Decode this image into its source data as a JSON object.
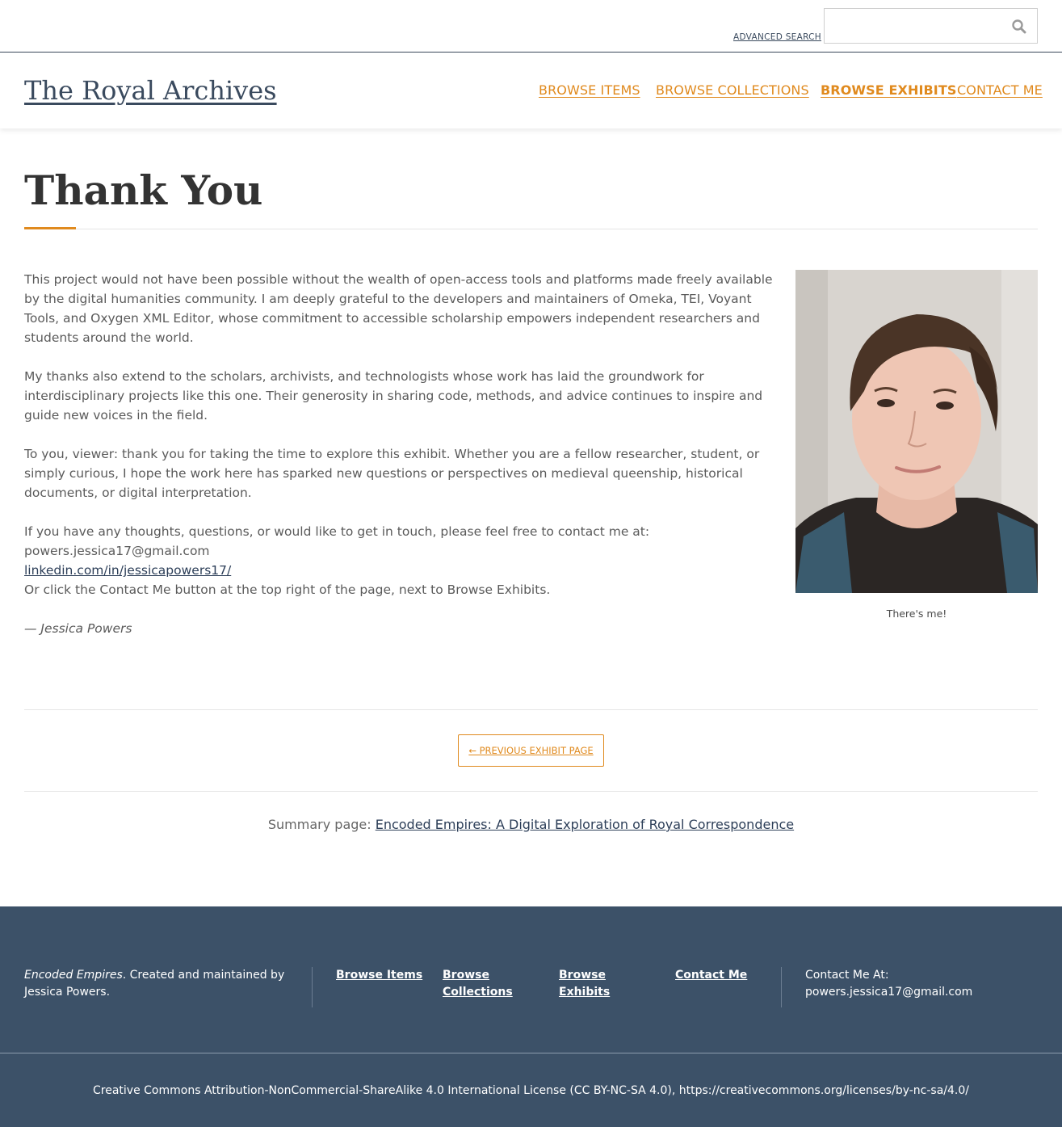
{
  "topbar": {
    "advanced_search_label": "ADVANCED SEARCH",
    "search_placeholder": ""
  },
  "header": {
    "site_title": "The Royal Archives",
    "nav": [
      {
        "label": "BROWSE ITEMS"
      },
      {
        "label": "BROWSE COLLECTIONS"
      },
      {
        "label": "BROWSE EXHIBITS",
        "active": true
      },
      {
        "label": "CONTACT ME"
      }
    ]
  },
  "page": {
    "title": "Thank You",
    "paragraphs": [
      "This project would not have been possible without the wealth of open-access tools and platforms made freely available by the digital humanities community. I am deeply grateful to the developers and maintainers of Omeka, TEI, Voyant Tools, and Oxygen XML Editor, whose commitment to accessible scholarship empowers independent researchers and students around the world.",
      "My thanks also extend to the scholars, archivists, and technologists whose work has laid the groundwork for interdisciplinary projects like this one. Their generosity in sharing code, methods, and advice continues to inspire and guide new voices in the field.",
      "To you, viewer: thank you for taking the time to explore this exhibit. Whether you are a fellow researcher, student, or simply curious, I hope the work here has sparked new questions or perspectives on medieval queenship, historical documents, or digital interpretation."
    ],
    "contact_intro": "If you have any thoughts, questions, or would like to get in touch, please feel free to contact me at:",
    "email": "powers.jessica17@gmail.com",
    "linkedin": "linkedin.com/in/jessicapowers17/",
    "contact_note": "Or click the Contact Me button at the top right of the page, next to Browse Exhibits.",
    "signature": "— Jessica Powers",
    "photo_caption": "There's me!"
  },
  "pagination": {
    "prev_label": "← PREVIOUS EXHIBIT PAGE"
  },
  "summary": {
    "prefix": "Summary page: ",
    "link": "Encoded Empires: A Digital Exploration of Royal Correspondence"
  },
  "footer": {
    "site_name": "Encoded Empires",
    "credit": ". Created and maintained by Jessica Powers.",
    "links": [
      "Browse Items",
      "Browse Collections",
      "Browse Exhibits",
      "Contact Me"
    ],
    "contact_label": "Contact Me At:",
    "contact_email": "powers.jessica17@gmail.com",
    "license": "Creative Commons Attribution-NonCommercial-ShareAlike 4.0 International License (CC BY-NC-SA 4.0), https://creativecommons.org/licenses/by-nc-sa/4.0/"
  },
  "colors": {
    "accent": "#e08a1e",
    "navy": "#3c5168",
    "link": "#2c3e58"
  }
}
